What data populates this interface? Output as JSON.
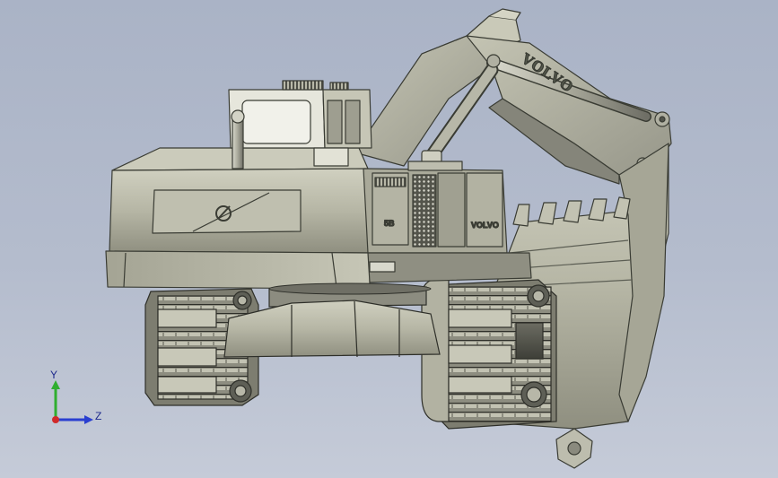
{
  "viewport": {
    "background_top": "#aab3c6",
    "background_bottom": "#c5cbd8"
  },
  "model": {
    "boom_brand_text": "VOLVO",
    "body_brand_text": "VOLVO",
    "body_model_text": "5B",
    "body_color": "#b9b9a8",
    "edge_color": "#3a3c34"
  },
  "triad": {
    "y_label": "Y",
    "z_label": "Z",
    "y_color": "#2fae2f",
    "z_color": "#2a3fd0",
    "x_color": "#d02a2a"
  }
}
